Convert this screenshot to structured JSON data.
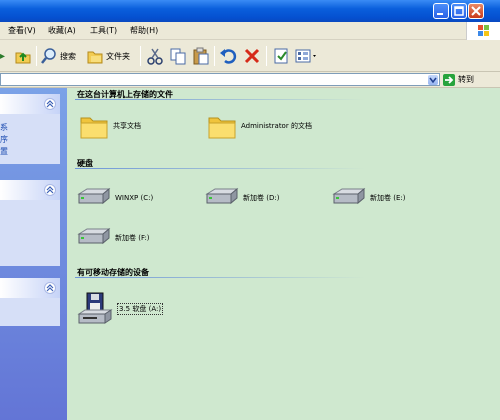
{
  "menu": {
    "items": [
      "查看(V)",
      "收藏(A)",
      "工具(T)",
      "帮助(H)"
    ]
  },
  "toolbar": {
    "search_label": "搜索",
    "folders_label": "文件夹"
  },
  "address": {
    "value": "",
    "go_label": "转到"
  },
  "left_pane": {
    "panel1_links": [
      "系",
      "序",
      "置"
    ]
  },
  "main": {
    "sections": {
      "stored": "在这台计算机上存储的文件",
      "hard_disks": "硬盘",
      "removable": "有可移动存储的设备"
    },
    "stored_items": [
      {
        "label": "共享文档",
        "icon": "folder-icon"
      },
      {
        "label": "Administrator 的文档",
        "icon": "folder-icon"
      }
    ],
    "drives": [
      {
        "label": "WINXP (C:)",
        "icon": "hard-drive-icon"
      },
      {
        "label": "新加卷 (D:)",
        "icon": "hard-drive-icon"
      },
      {
        "label": "新加卷 (E:)",
        "icon": "hard-drive-icon"
      },
      {
        "label": "新加卷 (F:)",
        "icon": "hard-drive-icon"
      }
    ],
    "removable_items": [
      {
        "label": "3.5 软盘 (A:)",
        "icon": "floppy-drive-icon"
      }
    ]
  },
  "colors": {
    "titlebar": "#0a5fdc",
    "content_bg": "#cfe8cf",
    "pane_link": "#1c4bb0",
    "close_button": "#c9391a"
  }
}
